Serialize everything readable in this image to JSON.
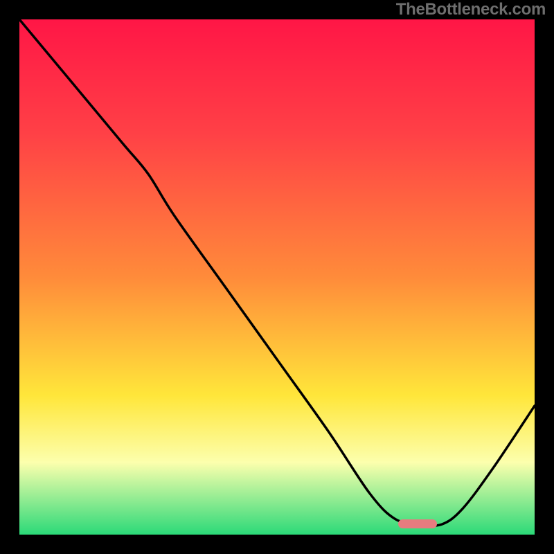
{
  "watermark": "TheBottleneck.com",
  "gradient": {
    "colors": {
      "top_red": "#ff1646",
      "mid_red": "#ff4046",
      "orange": "#ff8b3a",
      "yellow": "#ffe63a",
      "pale": "#fcffad",
      "green": "#2bd978"
    },
    "stops_pct": [
      0,
      22,
      50,
      73,
      86,
      100
    ]
  },
  "marker": {
    "color": "#e77b7f",
    "x_pct_range": [
      73.5,
      81.0
    ],
    "y_pct": 97.0,
    "height_pct": 1.8
  },
  "chart_data": {
    "type": "line",
    "title": "",
    "xlabel": "",
    "ylabel": "",
    "xlim": [
      0,
      100
    ],
    "ylim": [
      0,
      100
    ],
    "note": "y is the curve height as a percentage of the plotted area (0 = bottom, 100 = top). x is horizontal position in percent.",
    "series": [
      {
        "name": "curve",
        "x": [
          0,
          10,
          20,
          25,
          30,
          40,
          50,
          60,
          68,
          73,
          78,
          82,
          86,
          92,
          100
        ],
        "y": [
          100,
          88,
          76,
          70,
          62,
          48,
          34,
          20,
          8,
          3,
          2,
          2,
          5,
          13,
          25
        ]
      }
    ],
    "highlight_band_x": [
      73.5,
      81.0
    ],
    "highlight_near_bottom": true
  }
}
